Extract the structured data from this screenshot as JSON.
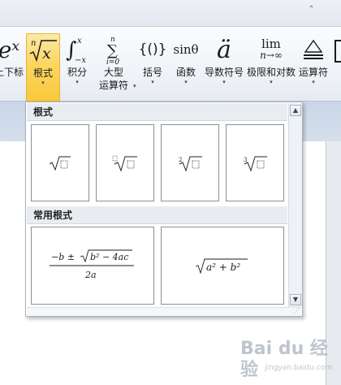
{
  "ribbon": {
    "buttons": [
      {
        "glyph": "eˣ",
        "label": "上下标",
        "dropdown": "▾"
      },
      {
        "glyph": "ⁿ√x",
        "label": "根式",
        "dropdown": "▾"
      },
      {
        "glyph": "∫",
        "label": "积分",
        "dropdown": "▾"
      },
      {
        "glyph": "∑",
        "label": "大型",
        "label2": "运算符",
        "dropdown": "▾"
      },
      {
        "glyph": "{()}",
        "label": "括号",
        "dropdown": "▾"
      },
      {
        "glyph": "sinθ",
        "label": "函数",
        "dropdown": "▾"
      },
      {
        "glyph": "ä",
        "label": "导数符号",
        "dropdown": "▾"
      },
      {
        "glyph": "lim",
        "glyph_sub": "n→∞",
        "label": "极限和对数",
        "dropdown": "▾"
      },
      {
        "glyph": "≜",
        "label": "运算符",
        "dropdown": "▾"
      }
    ],
    "integral_upper": "x",
    "integral_lower": "−x",
    "sum_upper": "n",
    "sum_lower": "i=0"
  },
  "gallery": {
    "section_radicals": "根式",
    "section_common": "常用根式",
    "radical_items": [
      {
        "name": "square-root",
        "index": ""
      },
      {
        "name": "nth-root",
        "index": "□"
      },
      {
        "name": "square-root-with-degree",
        "index": "2"
      },
      {
        "name": "cube-root",
        "index": "3"
      }
    ],
    "common_items": [
      {
        "name": "quadratic-formula",
        "numerator_prefix": "−b ±",
        "radicand": "b² − 4ac",
        "denominator": "2a"
      },
      {
        "name": "pythagorean-root",
        "radicand": "a² + b²"
      }
    ],
    "scroll_up": "▲",
    "scroll_down": "▼"
  },
  "watermark": {
    "text": "Bai du 经验",
    "sub": "jingyan.baidu.com"
  }
}
